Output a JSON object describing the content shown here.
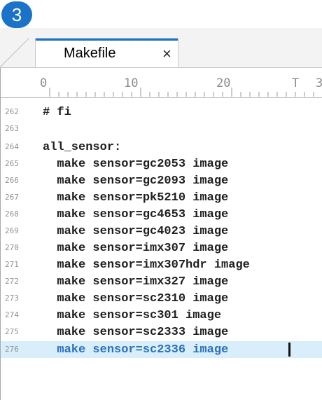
{
  "step_badge": "3",
  "tab": {
    "label": "Makefile",
    "close": "×"
  },
  "ruler": {
    "ticks": [
      {
        "label": "0"
      },
      {
        "label": "10"
      },
      {
        "label": "20"
      },
      {
        "label": "T"
      },
      {
        "label": "3"
      }
    ]
  },
  "lines": [
    {
      "number": "262",
      "text": "# fi",
      "highlighted": false
    },
    {
      "number": "263",
      "text": "",
      "highlighted": false
    },
    {
      "number": "264",
      "text": "all_sensor:",
      "highlighted": false
    },
    {
      "number": "265",
      "text": "  make sensor=gc2053 image",
      "highlighted": false
    },
    {
      "number": "266",
      "text": "  make sensor=gc2093 image",
      "highlighted": false
    },
    {
      "number": "267",
      "text": "  make sensor=pk5210 image",
      "highlighted": false
    },
    {
      "number": "268",
      "text": "  make sensor=gc4653 image",
      "highlighted": false
    },
    {
      "number": "269",
      "text": "  make sensor=gc4023 image",
      "highlighted": false
    },
    {
      "number": "270",
      "text": "  make sensor=imx307 image",
      "highlighted": false
    },
    {
      "number": "271",
      "text": "  make sensor=imx307hdr image",
      "highlighted": false
    },
    {
      "number": "272",
      "text": "  make sensor=imx327 image",
      "highlighted": false
    },
    {
      "number": "273",
      "text": "  make sensor=sc2310 image",
      "highlighted": false
    },
    {
      "number": "274",
      "text": "  make sensor=sc301 image",
      "highlighted": false
    },
    {
      "number": "275",
      "text": "  make sensor=sc2333 image",
      "highlighted": true
    },
    {
      "number": "276",
      "text": "  make sensor=sc2336 image",
      "highlighted": false
    }
  ],
  "colors": {
    "accent": "#1a73c9",
    "highlight_bg": "#d9eefb",
    "highlight_text": "#2b6fbf"
  }
}
